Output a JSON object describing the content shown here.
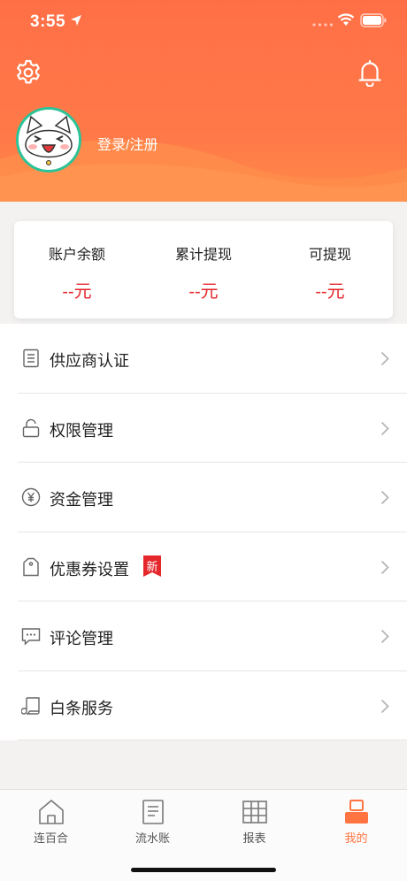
{
  "status_bar": {
    "time": "3:55"
  },
  "colors": {
    "accent": "#ff7440",
    "amount": "#e5262b",
    "avatar_ring": "#2cc397",
    "badge": "#e5262b"
  },
  "header": {
    "settings_icon": "gear-icon",
    "notification_icon": "bell-icon",
    "login_text": "登录/注册"
  },
  "balance_card": {
    "stats": [
      {
        "label": "账户余额",
        "value": "--元"
      },
      {
        "label": "累计提现",
        "value": "--元"
      },
      {
        "label": "可提现",
        "value": "--元"
      }
    ]
  },
  "menu": {
    "items": [
      {
        "label": "供应商认证",
        "icon": "document-icon"
      },
      {
        "label": "权限管理",
        "icon": "lock-icon"
      },
      {
        "label": "资金管理",
        "icon": "yen-icon"
      },
      {
        "label": "优惠券设置",
        "icon": "tag-icon",
        "badge": "新"
      },
      {
        "label": "评论管理",
        "icon": "comment-icon"
      },
      {
        "label": "白条服务",
        "icon": "scroll-icon"
      }
    ]
  },
  "tab_bar": {
    "tabs": [
      {
        "label": "连百合",
        "icon": "home-icon",
        "active": false
      },
      {
        "label": "流水账",
        "icon": "ledger-icon",
        "active": false
      },
      {
        "label": "报表",
        "icon": "table-icon",
        "active": false
      },
      {
        "label": "我的",
        "icon": "profile-icon",
        "active": true
      }
    ]
  }
}
